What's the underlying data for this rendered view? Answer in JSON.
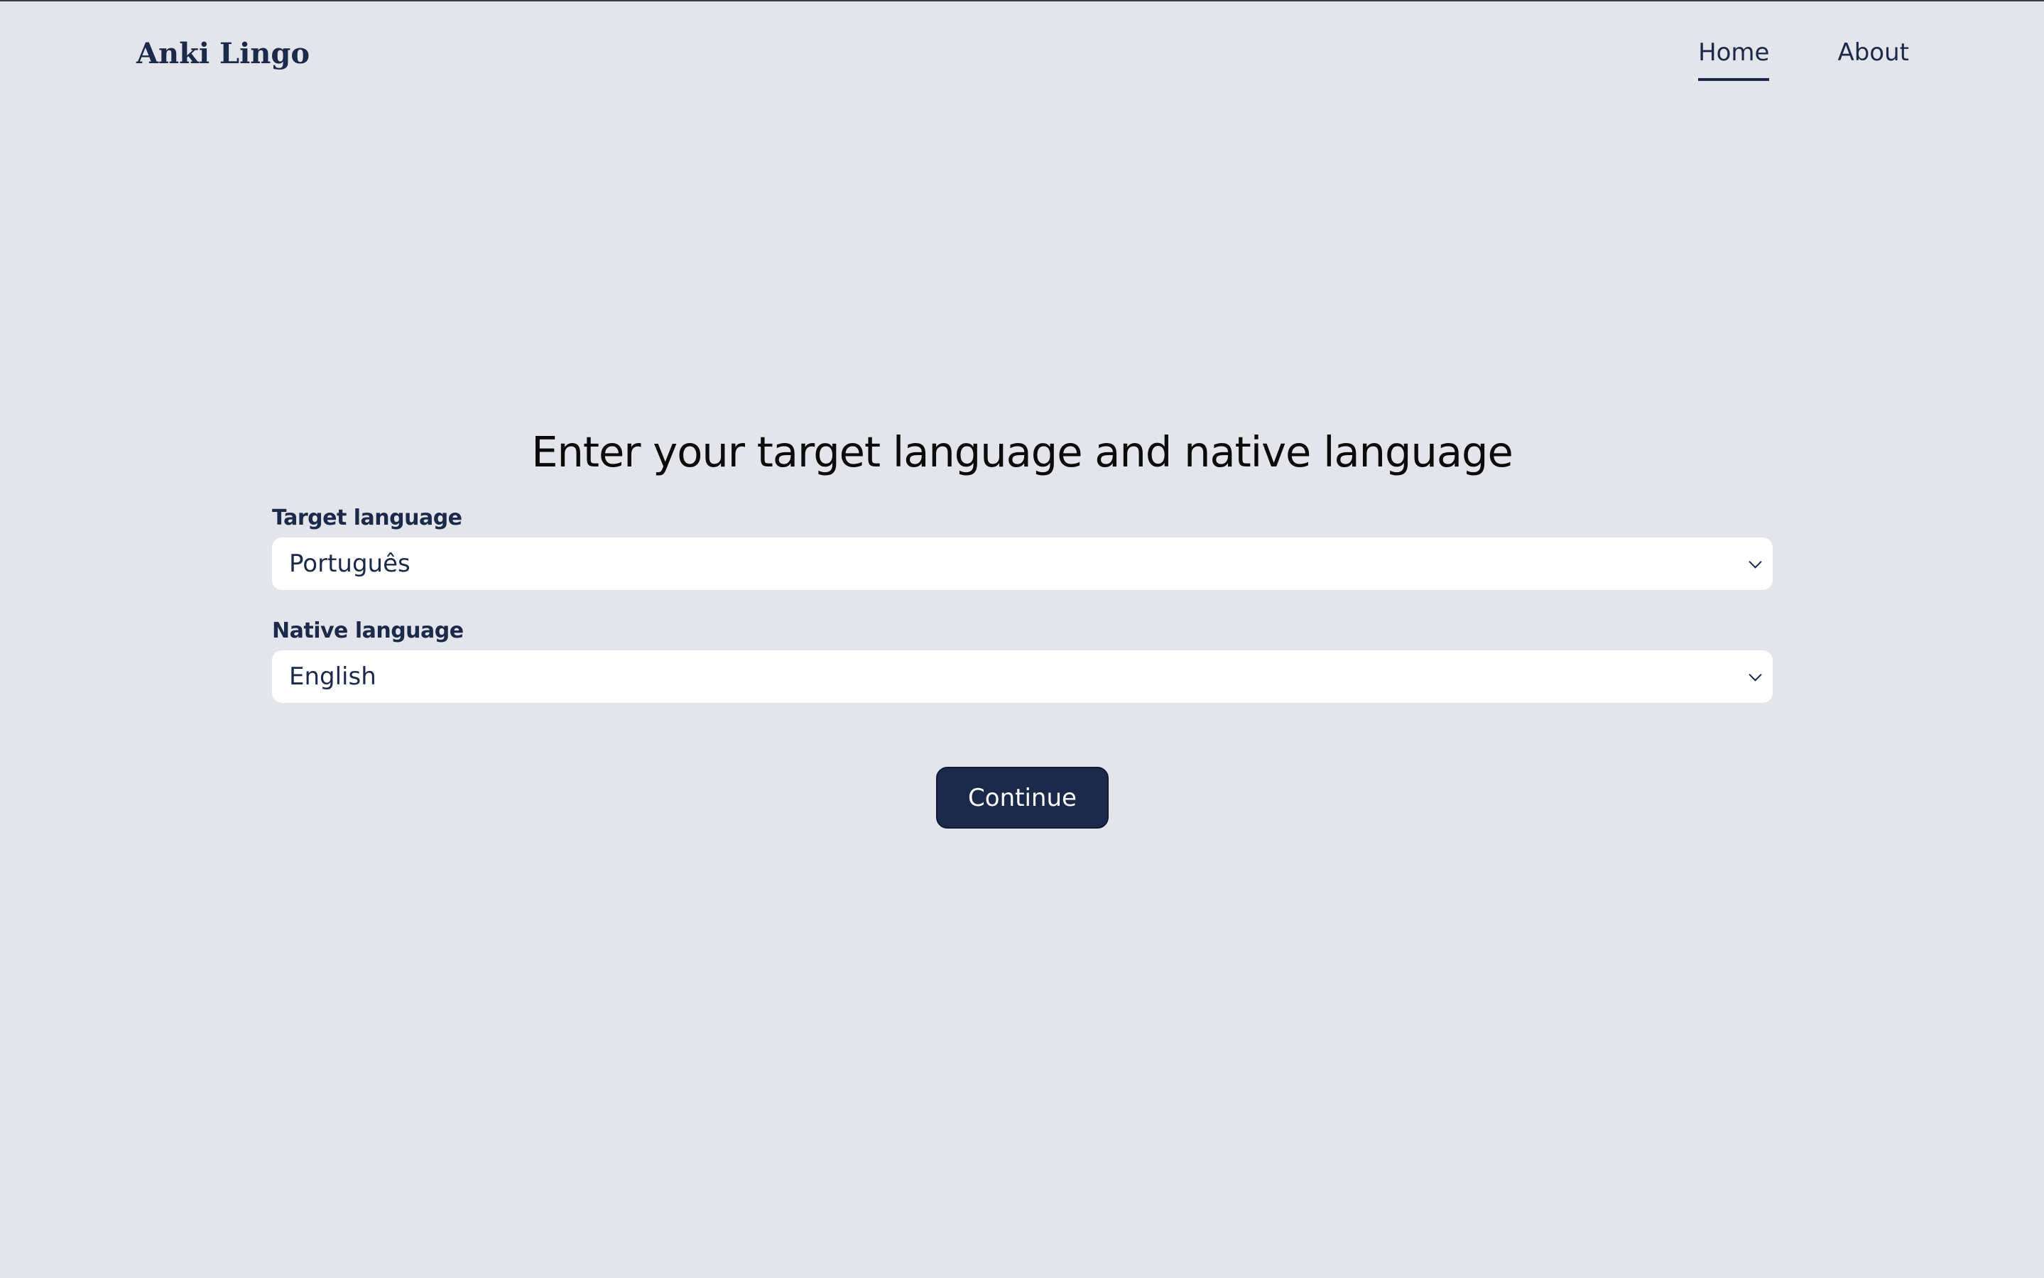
{
  "header": {
    "brand": "Anki Lingo",
    "nav": [
      {
        "label": "Home",
        "active": true
      },
      {
        "label": "About",
        "active": false
      }
    ]
  },
  "main": {
    "title": "Enter your target language and native language",
    "target": {
      "label": "Target language",
      "value": "Português"
    },
    "native": {
      "label": "Native language",
      "value": "English"
    },
    "continue_label": "Continue"
  },
  "icons": {
    "select_arrow": "chevron-down-icon"
  },
  "colors": {
    "background": "#e4e5ea",
    "primary": "#1b2a4a",
    "field_bg": "#ffffff"
  }
}
